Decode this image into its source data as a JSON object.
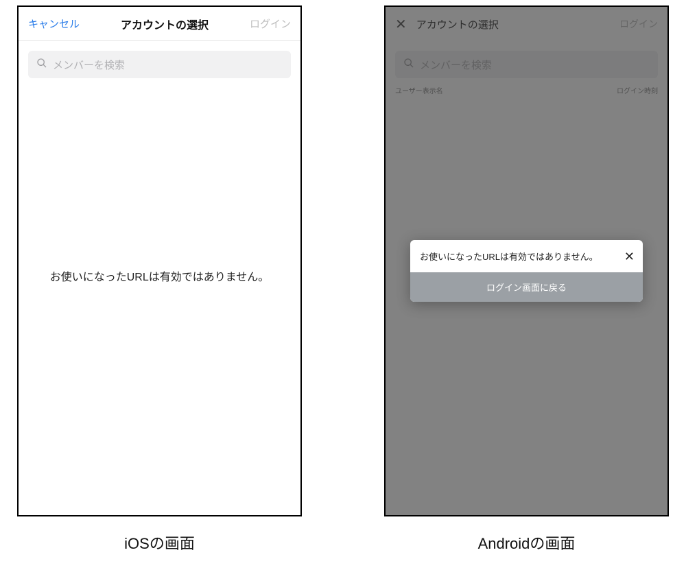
{
  "ios": {
    "nav": {
      "cancel": "キャンセル",
      "title": "アカウントの選択",
      "login": "ログイン"
    },
    "search": {
      "placeholder": "メンバーを検索"
    },
    "message": "お使いになったURLは有効ではありません。",
    "caption": "iOSの画面"
  },
  "android": {
    "nav": {
      "title": "アカウントの選択",
      "login": "ログイン"
    },
    "search": {
      "placeholder": "メンバーを検索"
    },
    "columns": {
      "user": "ユーザー表示名",
      "time": "ログイン時刻"
    },
    "dialog": {
      "message": "お使いになったURLは有効ではありません。",
      "button": "ログイン画面に戻る"
    },
    "caption": "Androidの画面"
  }
}
